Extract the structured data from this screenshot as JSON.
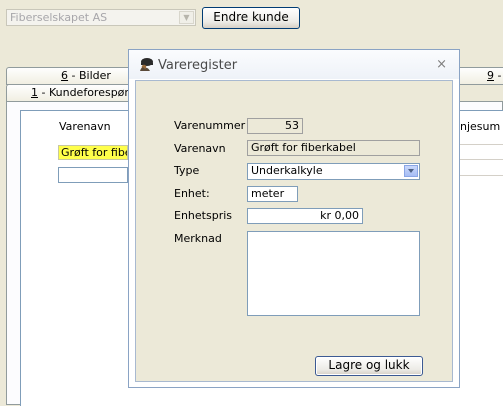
{
  "background": {
    "customer_combo": {
      "value": "Fiberselskapet AS"
    },
    "edit_customer_button": "Endre kunde",
    "tabs": [
      {
        "number": "6",
        "label": " - Bilder"
      },
      {
        "number": "1",
        "label": " - Kundeforespørsel"
      },
      {
        "number": "9",
        "label": " -"
      }
    ],
    "grid": {
      "col_varenavn": "Varenavn",
      "col_gjesum": "njesum",
      "selected_cell": "Grøft for fiberkabel"
    }
  },
  "dialog": {
    "title": "Vareregister",
    "close_symbol": "×",
    "fields": {
      "varenummer_label": "Varenummer",
      "varenummer_value": "53",
      "varenavn_label": "Varenavn",
      "varenavn_value": "Grøft for fiberkabel",
      "type_label": "Type",
      "type_value": "Underkalkyle",
      "enhet_label": "Enhet:",
      "enhet_value": "meter",
      "enhetspris_label": "Enhetspris",
      "enhetspris_value": "kr 0,00",
      "merknad_label": "Merknad",
      "merknad_value": ""
    },
    "save_button": "Lagre og lukk"
  }
}
